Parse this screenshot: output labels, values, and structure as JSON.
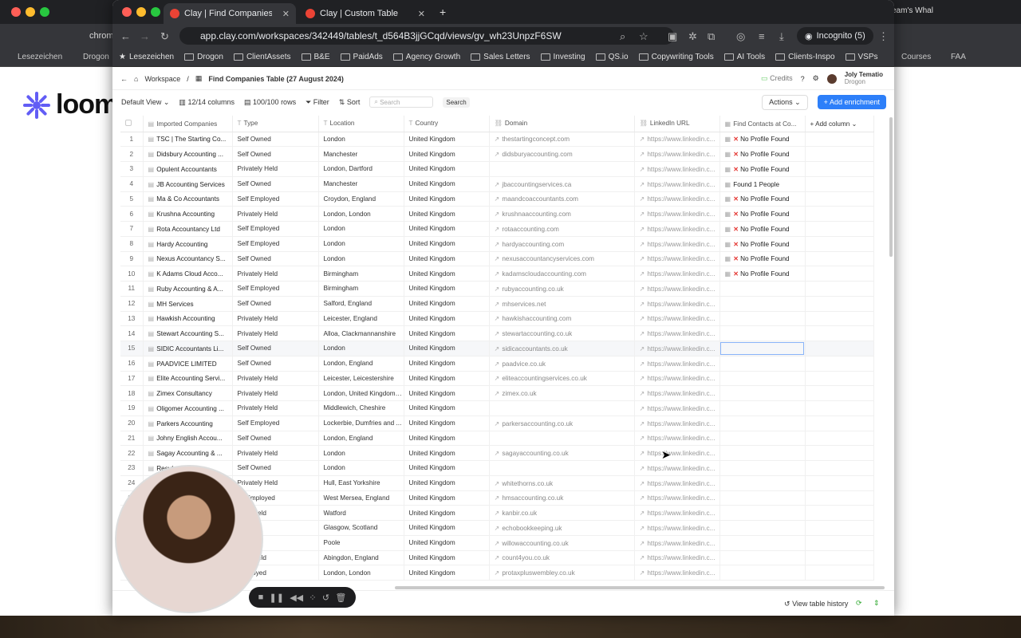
{
  "back": {
    "tab_label": "chrom",
    "right_tab_label": "eam's Whal",
    "bookmarks_left": [
      "Lesezeichen",
      "Drogon"
    ],
    "bookmarks_right": [
      "Courses",
      "FAA"
    ],
    "logo_word": "loom"
  },
  "browser": {
    "tabs": [
      {
        "label": "Clay | Find Companies Tab",
        "active": true
      },
      {
        "label": "Clay | Custom Table",
        "active": false
      }
    ],
    "url": "app.clay.com/workspaces/342449/tables/t_d564B3jjGCqd/views/gv_wh23UnpzF6SW",
    "incognito_label": "Incognito (5)",
    "bookmarks": [
      "Lesezeichen",
      "Drogon",
      "ClientAssets",
      "B&E",
      "PaidAds",
      "Agency Growth",
      "Sales Letters",
      "Investing",
      "QS.io",
      "Copywriting Tools",
      "AI Tools",
      "Clients-Inspo",
      "VSPs"
    ]
  },
  "app": {
    "breadcrumb_root": "Workspace",
    "table_title": "Find Companies Table (27 August 2024)",
    "credits_label": "Credits",
    "user_name": "Joly Tematio",
    "user_workspace": "Drogon",
    "view_label": "Default View",
    "columns_label": "12/14 columns",
    "rows_label": "100/100 rows",
    "filter_label": "Filter",
    "sort_label": "Sort",
    "search_placeholder": "Search",
    "search_button": "Search",
    "actions_label": "Actions",
    "add_enrichment_label": "Add enrichment",
    "add_column_label": "Add column",
    "view_history_label": "View table history"
  },
  "table": {
    "headers": [
      "Imported Companies",
      "Type",
      "Location",
      "Country",
      "Domain",
      "LinkedIn URL",
      "Find Contacts at Co..."
    ],
    "rows": [
      [
        "1",
        "TSC | The Starting Co...",
        "Self Owned",
        "London",
        "United Kingdom",
        "thestartingconcept.com",
        "https://www.linkedin.c...",
        "No Profile Found"
      ],
      [
        "2",
        "Didsbury Accounting ...",
        "Self Owned",
        "Manchester",
        "United Kingdom",
        "didsburyaccounting.com",
        "https://www.linkedin.c...",
        "No Profile Found"
      ],
      [
        "3",
        "Opulent Accountants",
        "Privately Held",
        "London, Dartford",
        "United Kingdom",
        "",
        "https://www.linkedin.c...",
        "No Profile Found"
      ],
      [
        "4",
        "JB Accounting Services",
        "Self Owned",
        "Manchester",
        "United Kingdom",
        "jbaccountingservices.ca",
        "https://www.linkedin.c...",
        "Found 1 People"
      ],
      [
        "5",
        "Ma & Co Accountants",
        "Self Employed",
        "Croydon, England",
        "United Kingdom",
        "maandcoaccountants.com",
        "https://www.linkedin.c...",
        "No Profile Found"
      ],
      [
        "6",
        "Krushna Accounting",
        "Privately Held",
        "London, London",
        "United Kingdom",
        "krushnaaccounting.com",
        "https://www.linkedin.c...",
        "No Profile Found"
      ],
      [
        "7",
        "Rota Accountancy Ltd",
        "Self Employed",
        "London",
        "United Kingdom",
        "rotaaccounting.com",
        "https://www.linkedin.c...",
        "No Profile Found"
      ],
      [
        "8",
        "Hardy Accounting",
        "Self Employed",
        "London",
        "United Kingdom",
        "hardyaccounting.com",
        "https://www.linkedin.c...",
        "No Profile Found"
      ],
      [
        "9",
        "Nexus Accountancy S...",
        "Self Owned",
        "London",
        "United Kingdom",
        "nexusaccountancyservices.com",
        "https://www.linkedin.c...",
        "No Profile Found"
      ],
      [
        "10",
        "K Adams Cloud Acco...",
        "Privately Held",
        "Birmingham",
        "United Kingdom",
        "kadamscloudaccounting.com",
        "https://www.linkedin.c...",
        "No Profile Found"
      ],
      [
        "11",
        "Ruby Accounting & A...",
        "Self Employed",
        "Birmingham",
        "United Kingdom",
        "rubyaccounting.co.uk",
        "https://www.linkedin.c...",
        ""
      ],
      [
        "12",
        "MH Services",
        "Self Owned",
        "Salford, England",
        "United Kingdom",
        "mhservices.net",
        "https://www.linkedin.c...",
        ""
      ],
      [
        "13",
        "Hawkish Accounting",
        "Privately Held",
        "Leicester, England",
        "United Kingdom",
        "hawkishaccounting.com",
        "https://www.linkedin.c...",
        ""
      ],
      [
        "14",
        "Stewart Accounting S...",
        "Privately Held",
        "Alloa, Clackmannanshire",
        "United Kingdom",
        "stewartaccounting.co.uk",
        "https://www.linkedin.c...",
        ""
      ],
      [
        "15",
        "SIDIC Accountants Li...",
        "Self Owned",
        "London",
        "United Kingdom",
        "sidicaccountants.co.uk",
        "https://www.linkedin.c...",
        ""
      ],
      [
        "16",
        "PAADVICE LIMITED",
        "Self Owned",
        "London, England",
        "United Kingdom",
        "paadvice.co.uk",
        "https://www.linkedin.c...",
        ""
      ],
      [
        "17",
        "Elite Accounting Servi...",
        "Privately Held",
        "Leicester, Leicestershire",
        "United Kingdom",
        "eliteaccountingservices.co.uk",
        "https://www.linkedin.c...",
        ""
      ],
      [
        "18",
        "Zimex Consultancy",
        "Privately Held",
        "London, United Kingdom, ...",
        "United Kingdom",
        "zimex.co.uk",
        "https://www.linkedin.c...",
        ""
      ],
      [
        "19",
        "Oligomer Accounting ...",
        "Privately Held",
        "Middlewich, Cheshire",
        "United Kingdom",
        "",
        "https://www.linkedin.c...",
        ""
      ],
      [
        "20",
        "Parkers Accounting",
        "Self Employed",
        "Lockerbie, Dumfries and ...",
        "United Kingdom",
        "parkersaccounting.co.uk",
        "https://www.linkedin.c...",
        ""
      ],
      [
        "21",
        "Johny English Accou...",
        "Self Owned",
        "London, England",
        "United Kingdom",
        "",
        "https://www.linkedin.c...",
        ""
      ],
      [
        "22",
        "Sagay Accounting & ...",
        "Privately Held",
        "London",
        "United Kingdom",
        "sagayaccounting.co.uk",
        "https://www.linkedin.c...",
        ""
      ],
      [
        "23",
        "Resul... ...tants ...",
        "Self Owned",
        "London",
        "United Kingdom",
        "",
        "https://www.linkedin.c...",
        ""
      ],
      [
        "24",
        "",
        "Privately Held",
        "Hull, East Yorkshire",
        "United Kingdom",
        "whitethorns.co.uk",
        "https://www.linkedin.c...",
        ""
      ],
      [
        "25",
        "",
        "elf Employed",
        "West Mersea, England",
        "United Kingdom",
        "hmsaccounting.co.uk",
        "https://www.linkedin.c...",
        ""
      ],
      [
        "26",
        "",
        "ately Held",
        "Watford",
        "United Kingdom",
        "kanbir.co.uk",
        "https://www.linkedin.c...",
        ""
      ],
      [
        "27",
        "",
        "mployed",
        "Glasgow, Scotland",
        "United Kingdom",
        "echobookkeeping.uk",
        "https://www.linkedin.c...",
        ""
      ],
      [
        "28",
        "",
        "mployed",
        "Poole",
        "United Kingdom",
        "willowaccounting.co.uk",
        "https://www.linkedin.c...",
        ""
      ],
      [
        "29",
        "",
        "ately Held",
        "Abingdon, England",
        "United Kingdom",
        "count4you.co.uk",
        "https://www.linkedin.c...",
        ""
      ],
      [
        "30",
        "",
        "Employed",
        "London, London",
        "United Kingdom",
        "protaxpluswembley.co.uk",
        "https://www.linkedin.c...",
        ""
      ]
    ]
  },
  "colors": {
    "accent": "#2d7ff9",
    "error": "#e53935"
  }
}
